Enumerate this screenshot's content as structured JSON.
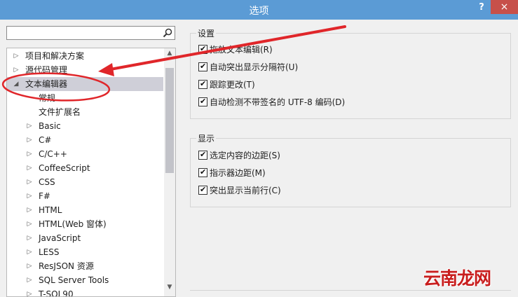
{
  "window": {
    "title": "选项",
    "help": "?",
    "close": "×"
  },
  "search": {
    "value": "",
    "placeholder": ""
  },
  "tree": {
    "items": [
      {
        "label": "项目和解决方案",
        "expander": "▷",
        "depth": 0
      },
      {
        "label": "源代码管理",
        "expander": "▷",
        "depth": 0
      },
      {
        "label": "文本编辑器",
        "expander": "◢",
        "depth": 0,
        "selected": true
      },
      {
        "label": "常规",
        "expander": "",
        "depth": 1
      },
      {
        "label": "文件扩展名",
        "expander": "",
        "depth": 1
      },
      {
        "label": "Basic",
        "expander": "▷",
        "depth": 1
      },
      {
        "label": "C#",
        "expander": "▷",
        "depth": 1
      },
      {
        "label": "C/C++",
        "expander": "▷",
        "depth": 1
      },
      {
        "label": "CoffeeScript",
        "expander": "▷",
        "depth": 1
      },
      {
        "label": "CSS",
        "expander": "▷",
        "depth": 1
      },
      {
        "label": "F#",
        "expander": "▷",
        "depth": 1
      },
      {
        "label": "HTML",
        "expander": "▷",
        "depth": 1
      },
      {
        "label": "HTML(Web 窗体)",
        "expander": "▷",
        "depth": 1
      },
      {
        "label": "JavaScript",
        "expander": "▷",
        "depth": 1
      },
      {
        "label": "LESS",
        "expander": "▷",
        "depth": 1
      },
      {
        "label": "ResJSON 资源",
        "expander": "▷",
        "depth": 1
      },
      {
        "label": "SQL Server Tools",
        "expander": "▷",
        "depth": 1
      },
      {
        "label": "T-SQL90",
        "expander": "▷",
        "depth": 1
      }
    ]
  },
  "settings_group": {
    "title": "设置",
    "options": [
      {
        "label": "拖放文本编辑(R)",
        "checked": true
      },
      {
        "label": "自动突出显示分隔符(U)",
        "checked": true
      },
      {
        "label": "跟踪更改(T)",
        "checked": true
      },
      {
        "label": "自动检测不带签名的 UTF-8 编码(D)",
        "checked": true
      }
    ]
  },
  "display_group": {
    "title": "显示",
    "options": [
      {
        "label": "选定内容的边距(S)",
        "checked": true
      },
      {
        "label": "指示器边距(M)",
        "checked": true
      },
      {
        "label": "突出显示当前行(C)",
        "checked": true
      }
    ]
  },
  "icons": {
    "search": "search-icon",
    "check": "✔",
    "scroll_up": "▲",
    "scroll_down": "▼"
  },
  "watermark": "云南龙网",
  "colors": {
    "titlebar": "#5b9bd5",
    "close": "#c7504a",
    "annotation": "#e0262a",
    "selection": "#cfcfd8"
  }
}
